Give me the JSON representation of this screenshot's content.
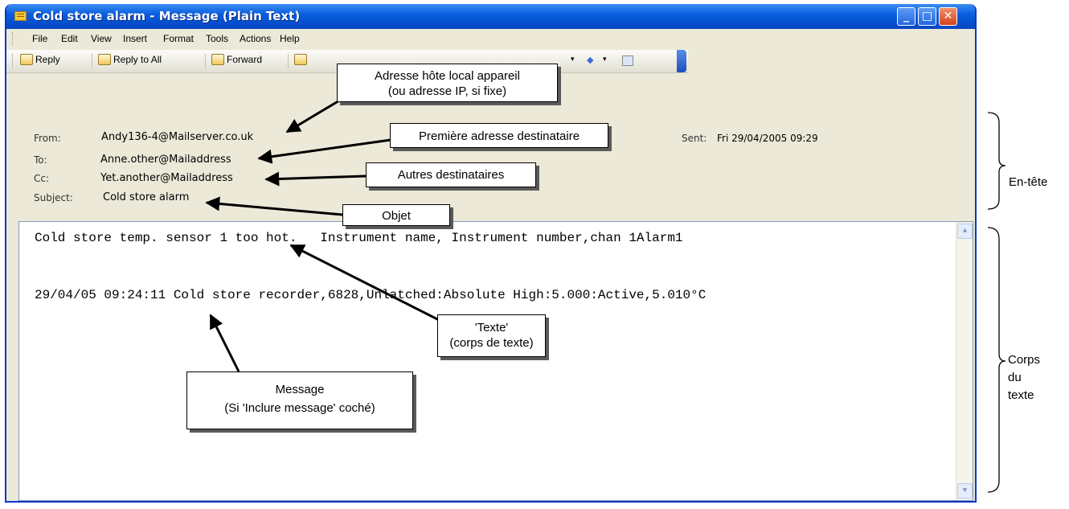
{
  "window": {
    "title": "Cold store alarm - Message (Plain Text)",
    "controls": {
      "minimize": "_",
      "maximize": "□",
      "close": "✕"
    }
  },
  "menu": [
    "File",
    "Edit",
    "View",
    "Insert",
    "Format",
    "Tools",
    "Actions",
    "Help"
  ],
  "toolbar": {
    "reply": "Reply",
    "reply_all": "Reply to All",
    "forward": "Forward"
  },
  "header": {
    "from_label": "From:",
    "from": "Andy136-4@Mailserver.co.uk",
    "to_label": "To:",
    "to": "Anne.other@Mailaddress",
    "cc_label": "Cc:",
    "cc": "Yet.another@Mailaddress",
    "subject_label": "Subject:",
    "subject": "Cold store alarm",
    "sent_label": "Sent:",
    "sent": "Fri 29/04/2005 09:29"
  },
  "body": {
    "line1": "Cold store temp. sensor 1 too hot.   Instrument name, Instrument number,chan 1Alarm1",
    "line2": "29/04/05 09:24:11 Cold store recorder,6828,Unlatched:Absolute High:5.000:Active,5.010°C"
  },
  "annotations": {
    "host": {
      "line1": "Adresse hôte local appareil",
      "line2": "(ou adresse IP, si fixe)"
    },
    "first_recipient": "Première adresse destinataire",
    "other_recipients": "Autres destinataires",
    "subject": "Objet",
    "text": {
      "line1": "'Texte'",
      "line2": "(corps de texte)"
    },
    "message": {
      "line1": "Message",
      "line2": "(Si 'Inclure message' coché)"
    }
  },
  "side_labels": {
    "header": "En-tête",
    "body": [
      "Corps",
      "du",
      "texte"
    ]
  }
}
